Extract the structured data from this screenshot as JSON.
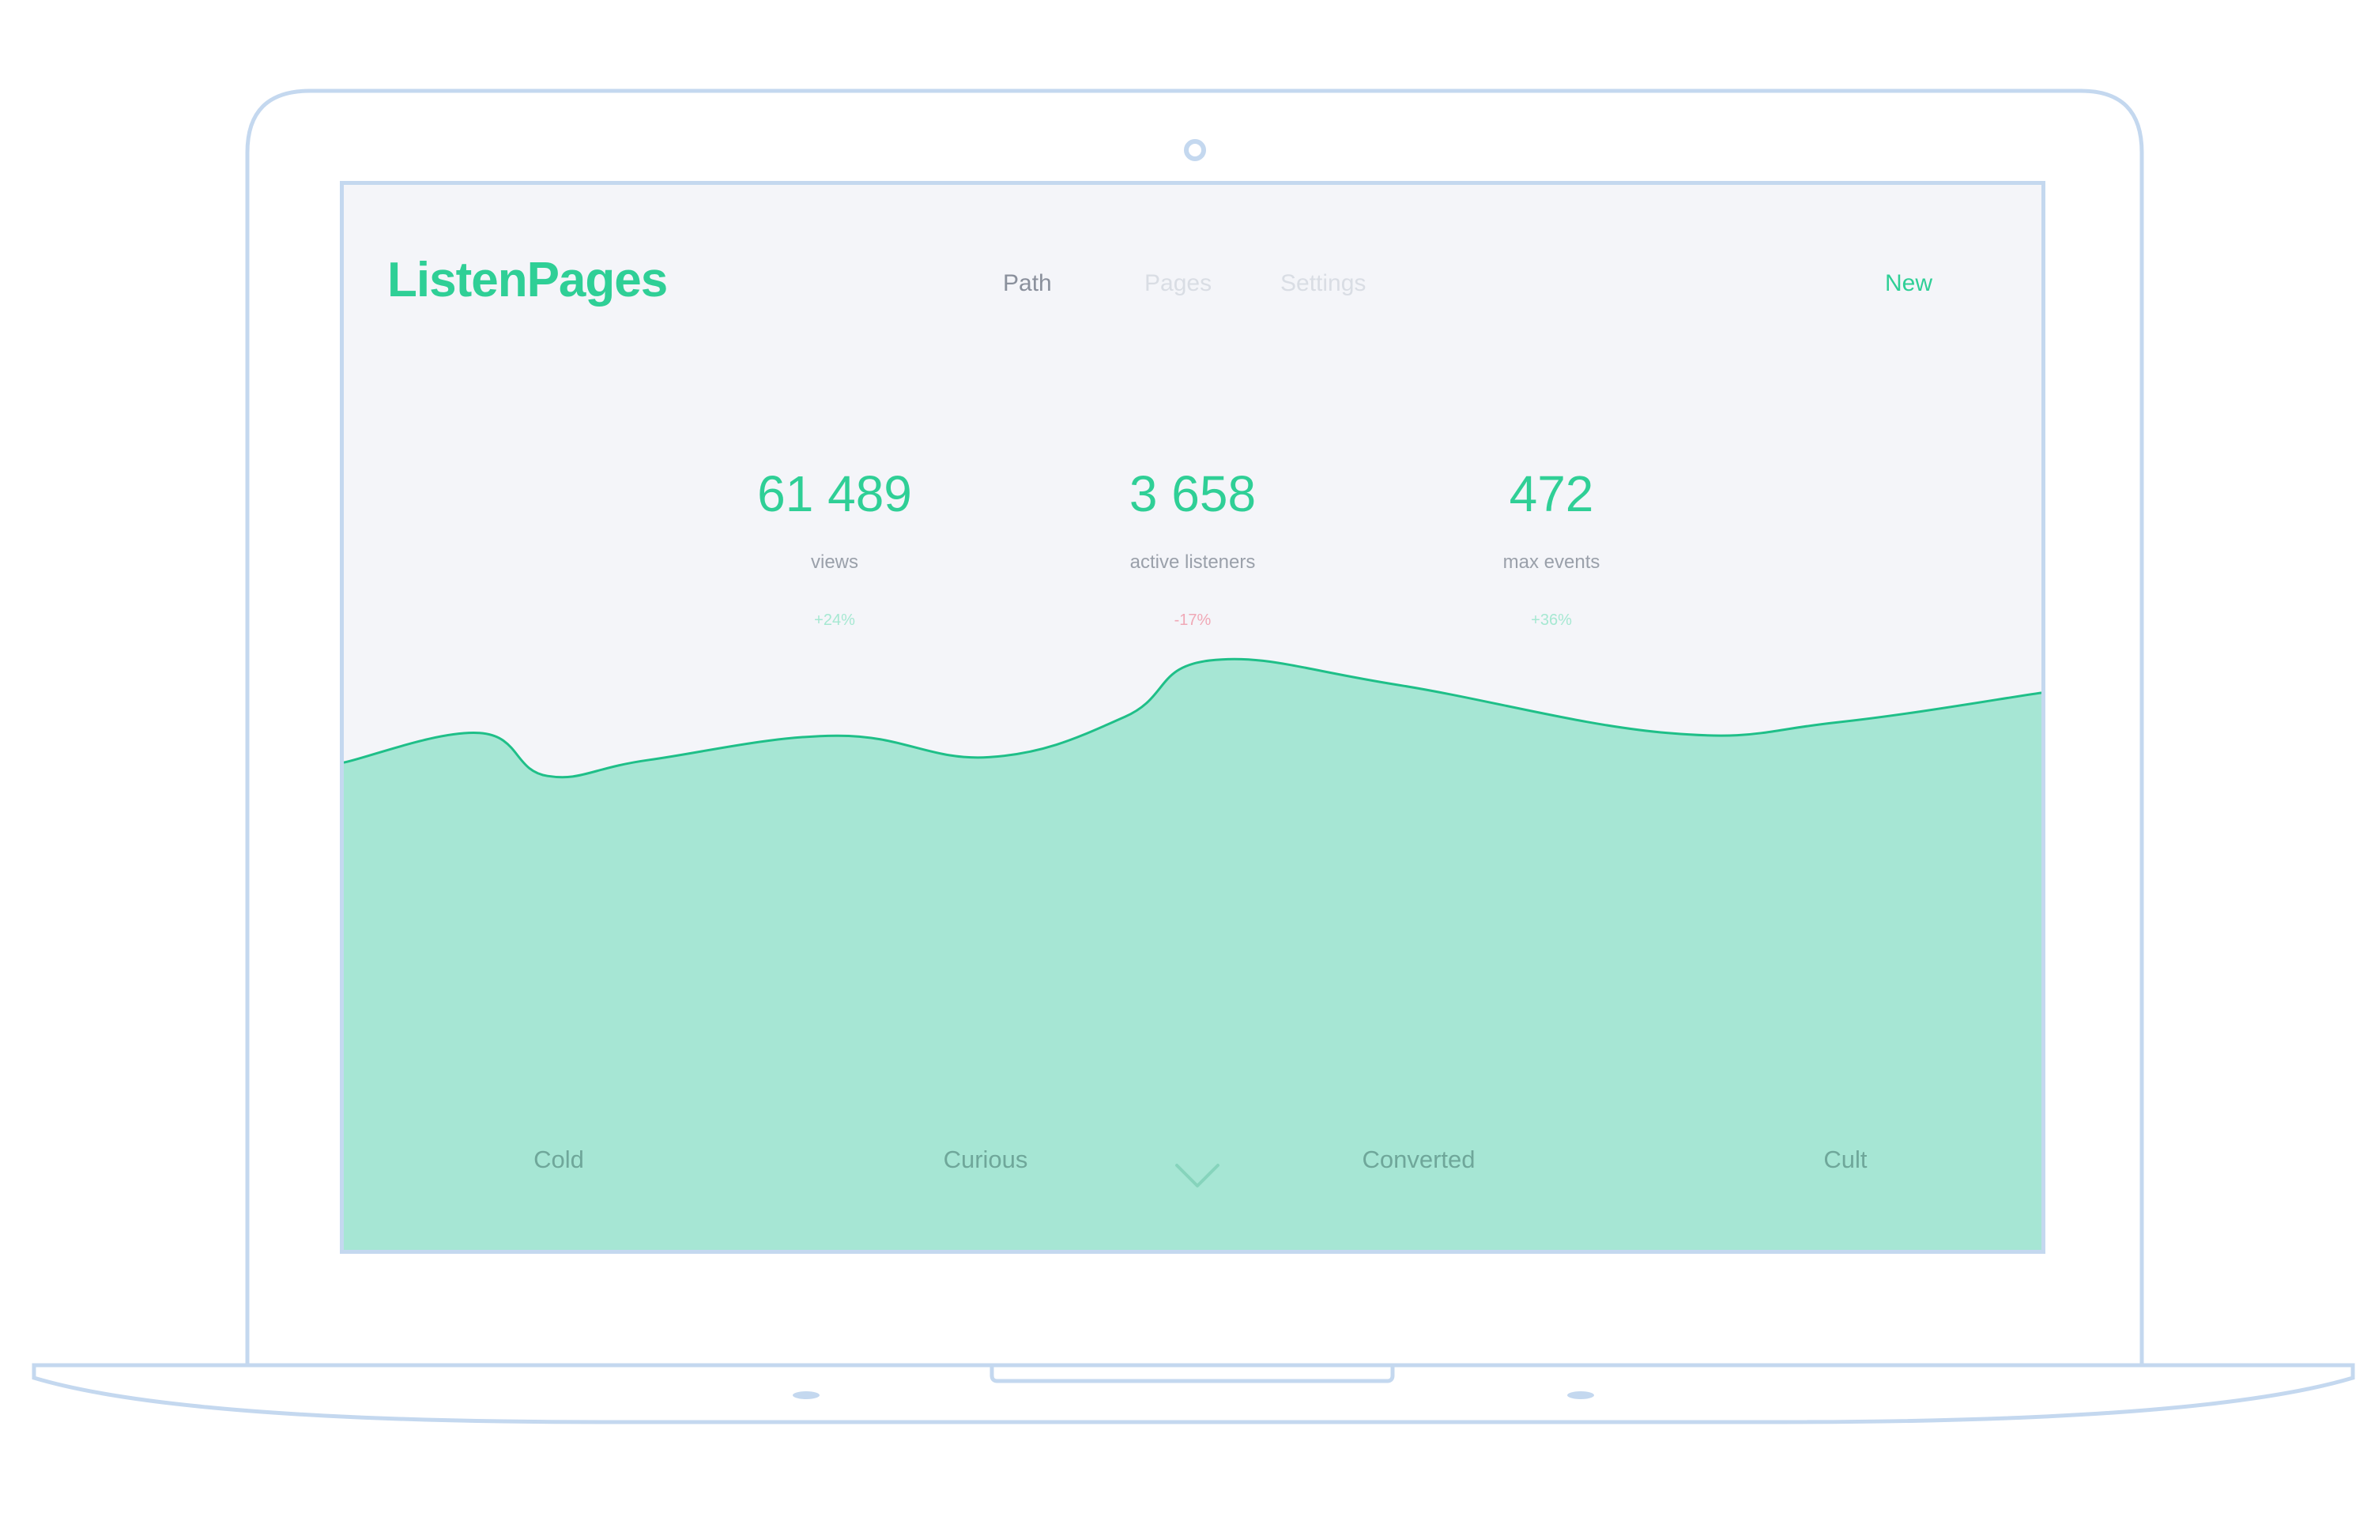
{
  "app": {
    "logo": "ListenPages",
    "brand_color": "#2fcf96"
  },
  "nav": {
    "items": [
      {
        "label": "Path",
        "state": "active"
      },
      {
        "label": "Pages",
        "state": "inactive"
      },
      {
        "label": "Settings",
        "state": "inactive"
      }
    ],
    "new_label": "New"
  },
  "stats": [
    {
      "value": "61 489",
      "label": "views",
      "delta": "+24%",
      "trend": "up"
    },
    {
      "value": "3 658",
      "label": "active listeners",
      "delta": "-17%",
      "trend": "down"
    },
    {
      "value": "472",
      "label": "max events",
      "delta": "+36%",
      "trend": "up"
    }
  ],
  "colors": {
    "up": "#a6e8d2",
    "down": "#f0a8b6",
    "area_fill": "#a6e6d4",
    "area_line": "#1fbf88",
    "device_outline": "#c4d8ef"
  },
  "stages": [
    "Cold",
    "Curious",
    "Converted",
    "Cult"
  ],
  "icons": {
    "scroll_indicator": "chevron-down-icon",
    "camera": "camera-icon"
  },
  "chart_data": {
    "type": "area",
    "x": [
      0,
      0.08,
      0.12,
      0.18,
      0.29,
      0.38,
      0.46,
      0.51,
      0.62,
      0.78,
      0.88,
      1.0
    ],
    "y": [
      0.38,
      0.27,
      0.43,
      0.37,
      0.28,
      0.36,
      0.21,
      0.0,
      0.09,
      0.27,
      0.23,
      0.12
    ]
  }
}
